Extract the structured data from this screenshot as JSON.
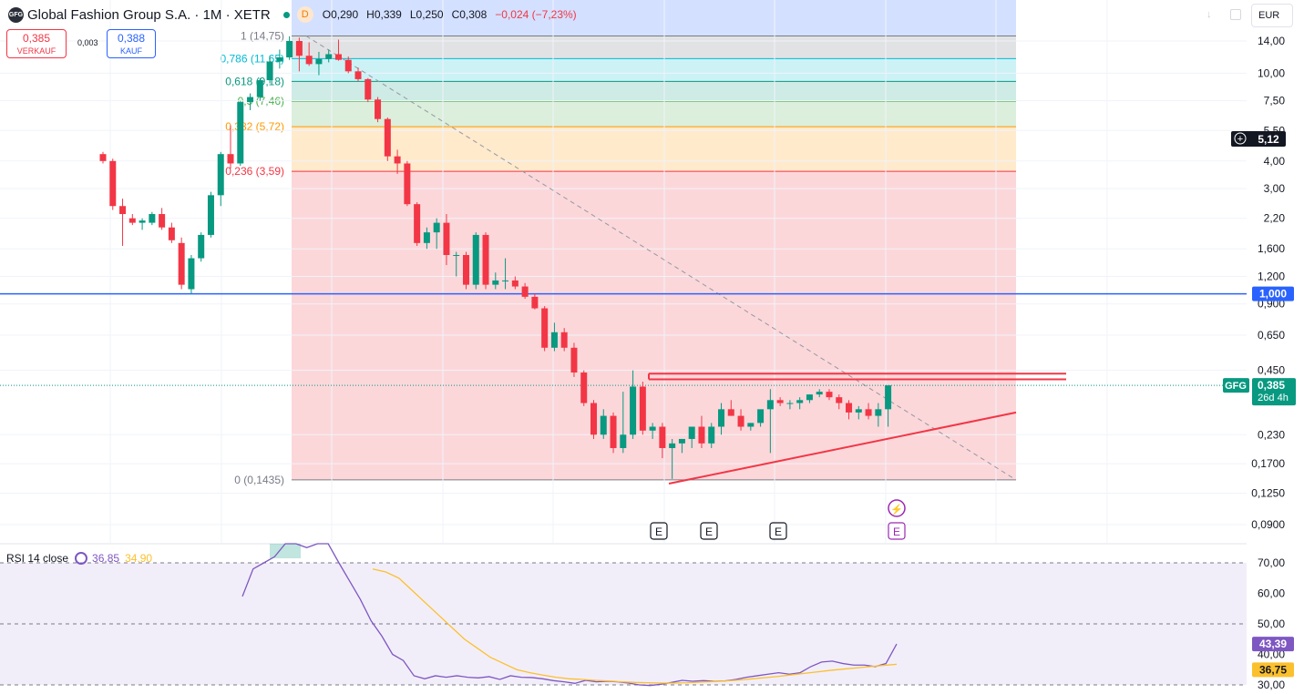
{
  "header": {
    "logo_text": "GFG",
    "title": "Global Fashion Group S.A. · 1M · XETR",
    "interval_badge": "D",
    "open": "0,290",
    "high": "0,339",
    "low": "0,250",
    "close": "0,308",
    "change": "−0,024 (−7,23%)",
    "o_label": "O",
    "h_label": "H",
    "l_label": "L",
    "c_label": "C"
  },
  "trade": {
    "sell_price": "0,385",
    "sell_label": "VERKAUF",
    "spread": "0,003",
    "buy_price": "0,388",
    "buy_label": "KAUF"
  },
  "currency": "EUR",
  "rsi_legend": {
    "label": "RSI 14 close",
    "rsi_value": "36,85",
    "ma_value": "34,90"
  },
  "colors": {
    "up": "#089981",
    "down": "#f23645",
    "rsi": "#7e57c2",
    "rsi_ma": "#fbc02d",
    "accent": "#2962ff"
  },
  "chart_data": [
    {
      "type": "candlestick",
      "symbol": "GFG",
      "scale": "log",
      "ylim": [
        0.085,
        16
      ],
      "y_ticks": [
        "14,00",
        "10,00",
        "7,50",
        "5,50",
        "4,00",
        "3,00",
        "2,20",
        "1,600",
        "1,200",
        "0,900",
        "0,650",
        "0,450",
        "0,230",
        "0,1700",
        "0,1250",
        "0,0900"
      ],
      "last_price_label": "0,385",
      "last_price_countdown": "26d 4h",
      "crosshair_price_label": "5,12",
      "hline_label": "1,000",
      "hline_value": 1.0,
      "fib_levels": [
        {
          "ratio": 1,
          "label": "1 (14,75)",
          "price": 14.75
        },
        {
          "ratio": 0.786,
          "label": "0,786 (11,65)",
          "price": 11.65
        },
        {
          "ratio": 0.618,
          "label": "0,618 (9,18)",
          "price": 9.18
        },
        {
          "ratio": 0.5,
          "label": "0,5 (7,46)",
          "price": 7.46
        },
        {
          "ratio": 0.382,
          "label": "0,382 (5,72)",
          "price": 5.72
        },
        {
          "ratio": 0.236,
          "label": "0,236 (3,59)",
          "price": 3.59
        },
        {
          "ratio": 0,
          "label": "0 (0,1435)",
          "price": 0.1435
        }
      ],
      "earnings_markers": [
        "E",
        "E",
        "E",
        "E"
      ],
      "ohlc": [
        [
          4.3,
          4.4,
          3.9,
          4.0
        ],
        [
          4.0,
          4.1,
          2.4,
          2.5
        ],
        [
          2.5,
          2.7,
          1.65,
          2.3
        ],
        [
          2.2,
          2.3,
          2.05,
          2.1
        ],
        [
          2.1,
          2.2,
          1.95,
          2.15
        ],
        [
          2.1,
          2.35,
          2.05,
          2.3
        ],
        [
          2.3,
          2.45,
          1.95,
          2.0
        ],
        [
          2.0,
          2.1,
          1.7,
          1.75
        ],
        [
          1.7,
          1.8,
          1.05,
          1.1
        ],
        [
          1.05,
          1.5,
          1.0,
          1.45
        ],
        [
          1.45,
          1.9,
          1.4,
          1.85
        ],
        [
          1.85,
          2.9,
          1.8,
          2.8
        ],
        [
          2.8,
          4.4,
          2.5,
          4.3
        ],
        [
          4.3,
          5.8,
          3.7,
          3.9
        ],
        [
          3.9,
          7.5,
          3.8,
          7.4
        ],
        [
          7.4,
          8.1,
          6.8,
          7.8
        ],
        [
          7.8,
          9.5,
          7.5,
          9.3
        ],
        [
          9.3,
          12.0,
          9.0,
          11.3
        ],
        [
          11.3,
          12.8,
          10.5,
          11.8
        ],
        [
          11.8,
          14.7,
          11.5,
          14.0
        ],
        [
          14.0,
          14.5,
          10.2,
          12.0
        ],
        [
          12.0,
          13.8,
          10.8,
          11.0
        ],
        [
          11.0,
          12.5,
          9.8,
          11.6
        ],
        [
          11.6,
          12.8,
          11.2,
          12.2
        ],
        [
          12.2,
          14.2,
          11.4,
          11.5
        ],
        [
          11.5,
          11.9,
          10.0,
          10.2
        ],
        [
          10.2,
          10.6,
          9.2,
          9.4
        ],
        [
          9.4,
          9.5,
          7.4,
          7.6
        ],
        [
          7.6,
          7.8,
          6.0,
          6.2
        ],
        [
          6.2,
          6.3,
          4.0,
          4.2
        ],
        [
          4.2,
          4.5,
          3.5,
          3.9
        ],
        [
          3.9,
          4.0,
          2.5,
          2.55
        ],
        [
          2.55,
          2.6,
          1.65,
          1.7
        ],
        [
          1.7,
          2.0,
          1.6,
          1.9
        ],
        [
          1.9,
          2.2,
          1.6,
          2.1
        ],
        [
          2.1,
          2.3,
          1.35,
          1.5
        ],
        [
          1.5,
          1.55,
          1.2,
          1.5
        ],
        [
          1.5,
          1.55,
          1.05,
          1.1
        ],
        [
          1.1,
          1.9,
          1.05,
          1.85
        ],
        [
          1.85,
          1.9,
          1.05,
          1.1
        ],
        [
          1.1,
          1.25,
          1.05,
          1.15
        ],
        [
          1.15,
          1.45,
          1.05,
          1.15
        ],
        [
          1.15,
          1.2,
          1.05,
          1.08
        ],
        [
          1.08,
          1.12,
          0.95,
          0.97
        ],
        [
          0.97,
          1.0,
          0.85,
          0.86
        ],
        [
          0.86,
          0.88,
          0.55,
          0.57
        ],
        [
          0.57,
          0.74,
          0.55,
          0.67
        ],
        [
          0.67,
          0.7,
          0.55,
          0.57
        ],
        [
          0.57,
          0.6,
          0.42,
          0.44
        ],
        [
          0.44,
          0.45,
          0.31,
          0.32
        ],
        [
          0.32,
          0.33,
          0.22,
          0.23
        ],
        [
          0.23,
          0.3,
          0.22,
          0.28
        ],
        [
          0.28,
          0.29,
          0.19,
          0.2
        ],
        [
          0.2,
          0.36,
          0.19,
          0.23
        ],
        [
          0.23,
          0.45,
          0.22,
          0.38
        ],
        [
          0.38,
          0.4,
          0.23,
          0.24
        ],
        [
          0.24,
          0.26,
          0.22,
          0.25
        ],
        [
          0.25,
          0.26,
          0.18,
          0.2
        ],
        [
          0.2,
          0.22,
          0.145,
          0.21
        ],
        [
          0.21,
          0.22,
          0.19,
          0.22
        ],
        [
          0.22,
          0.25,
          0.2,
          0.25
        ],
        [
          0.25,
          0.28,
          0.2,
          0.21
        ],
        [
          0.21,
          0.26,
          0.2,
          0.25
        ],
        [
          0.25,
          0.32,
          0.23,
          0.3
        ],
        [
          0.3,
          0.33,
          0.28,
          0.28
        ],
        [
          0.28,
          0.3,
          0.24,
          0.25
        ],
        [
          0.25,
          0.26,
          0.24,
          0.26
        ],
        [
          0.26,
          0.28,
          0.25,
          0.3
        ],
        [
          0.3,
          0.37,
          0.19,
          0.33
        ],
        [
          0.33,
          0.34,
          0.31,
          0.32
        ],
        [
          0.32,
          0.33,
          0.3,
          0.32
        ],
        [
          0.32,
          0.34,
          0.3,
          0.33
        ],
        [
          0.33,
          0.35,
          0.32,
          0.35
        ],
        [
          0.35,
          0.37,
          0.34,
          0.36
        ],
        [
          0.36,
          0.37,
          0.33,
          0.34
        ],
        [
          0.34,
          0.35,
          0.3,
          0.32
        ],
        [
          0.32,
          0.33,
          0.27,
          0.29
        ],
        [
          0.29,
          0.31,
          0.27,
          0.3
        ],
        [
          0.3,
          0.32,
          0.27,
          0.28
        ],
        [
          0.28,
          0.32,
          0.25,
          0.3
        ],
        [
          0.3,
          0.339,
          0.25,
          0.385
        ]
      ]
    },
    {
      "type": "line",
      "title": "RSI 14 close",
      "ylim": [
        28,
        75
      ],
      "y_ticks": [
        "70,00",
        "60,00",
        "50,00",
        "40,00",
        "30,00"
      ],
      "levels": [
        70,
        50,
        30
      ],
      "series": [
        {
          "name": "RSI",
          "color": "#7e57c2",
          "last_label": "43,39",
          "values": [
            59,
            68,
            70,
            72,
            78,
            80,
            75,
            80,
            77,
            70,
            64,
            58,
            51,
            46,
            40,
            38,
            33,
            32,
            33,
            32.5,
            33,
            32.5,
            32.3,
            32.7,
            31.8,
            33,
            32.5,
            32.4,
            32,
            31.4,
            31,
            30.5,
            31.5,
            31,
            31.2,
            31,
            30.6,
            30,
            29.8,
            30.2,
            30.8,
            31.5,
            31.2,
            31.4,
            31.2,
            31.3,
            31.8,
            32.5,
            33,
            33.5,
            34,
            33.5,
            34,
            36,
            37.5,
            37.8,
            37,
            36.5,
            36.5,
            36,
            37,
            43.4
          ]
        },
        {
          "name": "MA",
          "color": "#fbc02d",
          "last_label": "36,75",
          "values": [
            68,
            67,
            65,
            61,
            57,
            53,
            49,
            45,
            42,
            39,
            37,
            35,
            34,
            33.2,
            32.5,
            32,
            31.8,
            31.5,
            31.3,
            31,
            30.8,
            30.7,
            30.6,
            30.6,
            30.7,
            30.9,
            31.1,
            31.3,
            31.6,
            32,
            32.4,
            32.8,
            33.3,
            33.8,
            34.3,
            34.8,
            35.2,
            35.6,
            36,
            36.4,
            36.75
          ]
        }
      ]
    }
  ]
}
